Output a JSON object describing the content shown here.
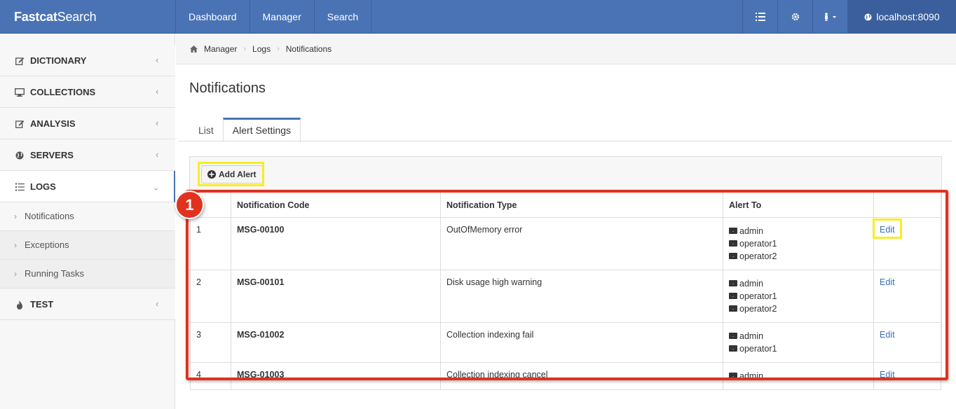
{
  "app": {
    "brand_bold": "Fastcat",
    "brand_light": "Search"
  },
  "topnav": {
    "items": [
      "Dashboard",
      "Manager",
      "Search"
    ]
  },
  "topright": {
    "icons": [
      "list-icon",
      "gear-icon",
      "user-icon"
    ],
    "host": "localhost:8090"
  },
  "sidebar": {
    "items": [
      {
        "label": "DICTIONARY",
        "icon": "edit-icon"
      },
      {
        "label": "COLLECTIONS",
        "icon": "desktop-icon"
      },
      {
        "label": "ANALYSIS",
        "icon": "edit-icon"
      },
      {
        "label": "SERVERS",
        "icon": "globe-icon"
      },
      {
        "label": "LOGS",
        "icon": "list-icon"
      },
      {
        "label": "TEST",
        "icon": "fire-icon"
      }
    ],
    "sub_items": [
      "Notifications",
      "Exceptions",
      "Running Tasks"
    ]
  },
  "breadcrumb": [
    "Manager",
    "Logs",
    "Notifications"
  ],
  "page": {
    "title": "Notifications"
  },
  "tabs": [
    "List",
    "Alert Settings"
  ],
  "add_button": "Add Alert",
  "table": {
    "headers": [
      "",
      "Notification Code",
      "Notification Type",
      "Alert To",
      ""
    ],
    "rows": [
      {
        "num": "1",
        "code": "MSG-00100",
        "type": "OutOfMemory error",
        "recipients": [
          "admin",
          "operator1",
          "operator2"
        ],
        "action": "Edit"
      },
      {
        "num": "2",
        "code": "MSG-00101",
        "type": "Disk usage high warning",
        "recipients": [
          "admin",
          "operator1",
          "operator2"
        ],
        "action": "Edit"
      },
      {
        "num": "3",
        "code": "MSG-01002",
        "type": "Collection indexing fail",
        "recipients": [
          "admin",
          "operator1"
        ],
        "action": "Edit"
      },
      {
        "num": "4",
        "code": "MSG-01003",
        "type": "Collection indexing cancel",
        "recipients": [
          "admin"
        ],
        "action": "Edit"
      }
    ]
  },
  "annotation": {
    "badge": "1",
    "red": "#e0321f",
    "yellow": "#f7ed25"
  },
  "colors": {
    "accent": "#4a73b5",
    "link": "#3a6fb5"
  }
}
